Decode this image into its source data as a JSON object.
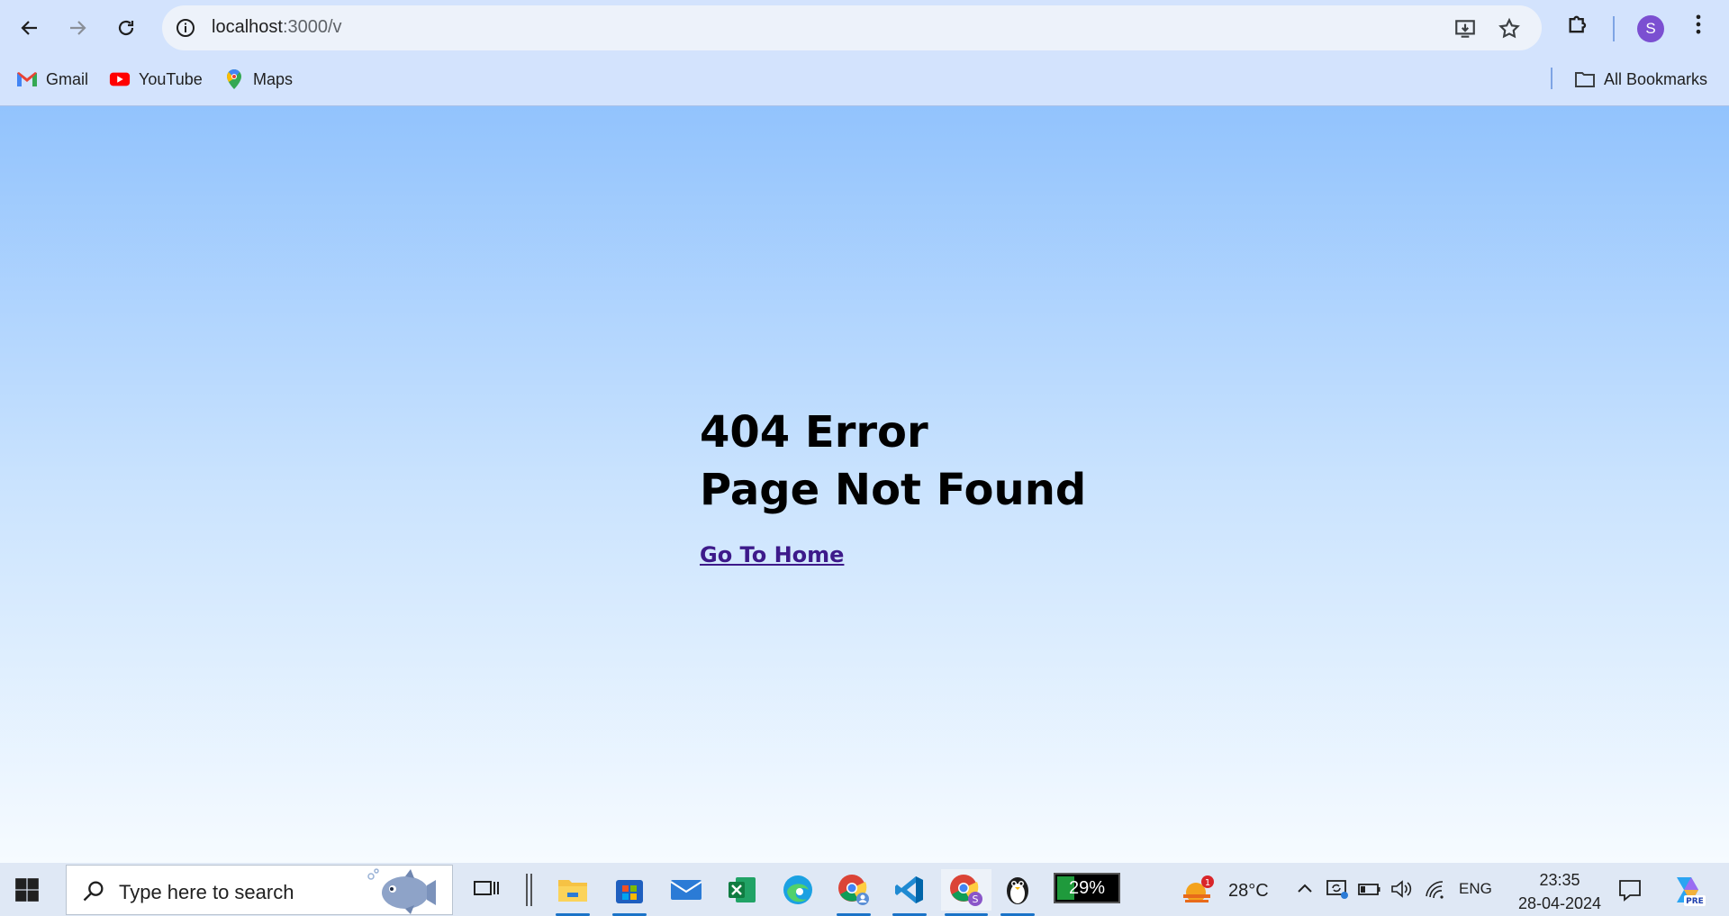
{
  "browser": {
    "url_host": "localhost",
    "url_path": ":3000/v",
    "bookmarks": [
      {
        "label": "Gmail",
        "icon": "gmail-icon"
      },
      {
        "label": "YouTube",
        "icon": "youtube-icon"
      },
      {
        "label": "Maps",
        "icon": "maps-icon"
      }
    ],
    "all_bookmarks_label": "All Bookmarks",
    "profile_initial": "S"
  },
  "page": {
    "title": "404 Error",
    "subtitle": "Page Not Found",
    "home_link": "Go To Home"
  },
  "taskbar": {
    "search_placeholder": "Type here to search",
    "battery_widget_percent": "29%",
    "battery_level": 0.29,
    "weather_badge": "1",
    "temperature": "28°C",
    "language": "ENG",
    "time": "23:35",
    "date": "28-04-2024",
    "copilot_badge": "PRE"
  },
  "colors": {
    "chrome_bg": "#d3e3fd",
    "page_top": "#92c3fd",
    "page_bottom": "#f6fbff",
    "link": "#3d1a8a"
  }
}
